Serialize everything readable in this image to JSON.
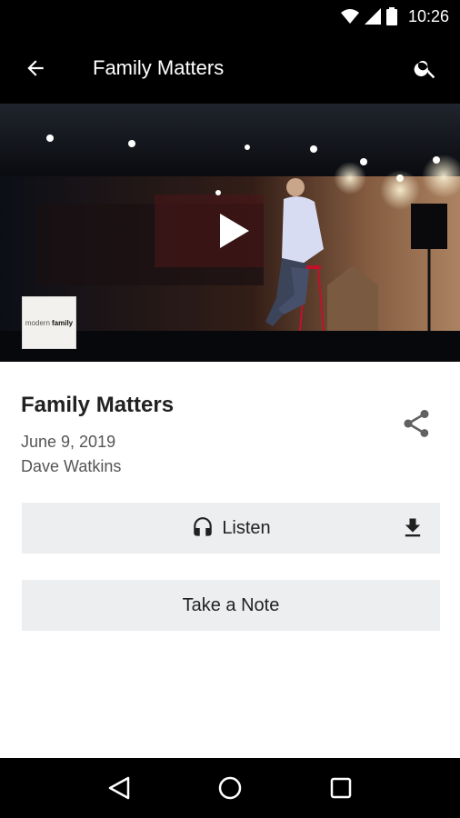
{
  "status_bar": {
    "time": "10:26",
    "icons": [
      "wifi-icon",
      "cell-signal-icon",
      "battery-icon"
    ]
  },
  "app_bar": {
    "title": "Family Matters",
    "back_icon": "arrow-back-icon",
    "search_icon": "search-icon"
  },
  "hero": {
    "play_icon": "play-icon",
    "thumbnail": {
      "text_light": "modern",
      "text_bold": "family"
    }
  },
  "sermon": {
    "title": "Family Matters",
    "date": "June 9, 2019",
    "speaker": "Dave Watkins",
    "share_icon": "share-icon"
  },
  "actions": {
    "listen_label": "Listen",
    "listen_icon": "headphones-icon",
    "download_icon": "download-icon",
    "note_label": "Take a Note"
  },
  "nav_bar": {
    "icons": [
      "nav-back-icon",
      "nav-home-icon",
      "nav-recents-icon"
    ]
  },
  "colors": {
    "bars": "#000000",
    "button_bg": "#eceef0",
    "text_primary": "#212121",
    "text_secondary": "#555555"
  }
}
